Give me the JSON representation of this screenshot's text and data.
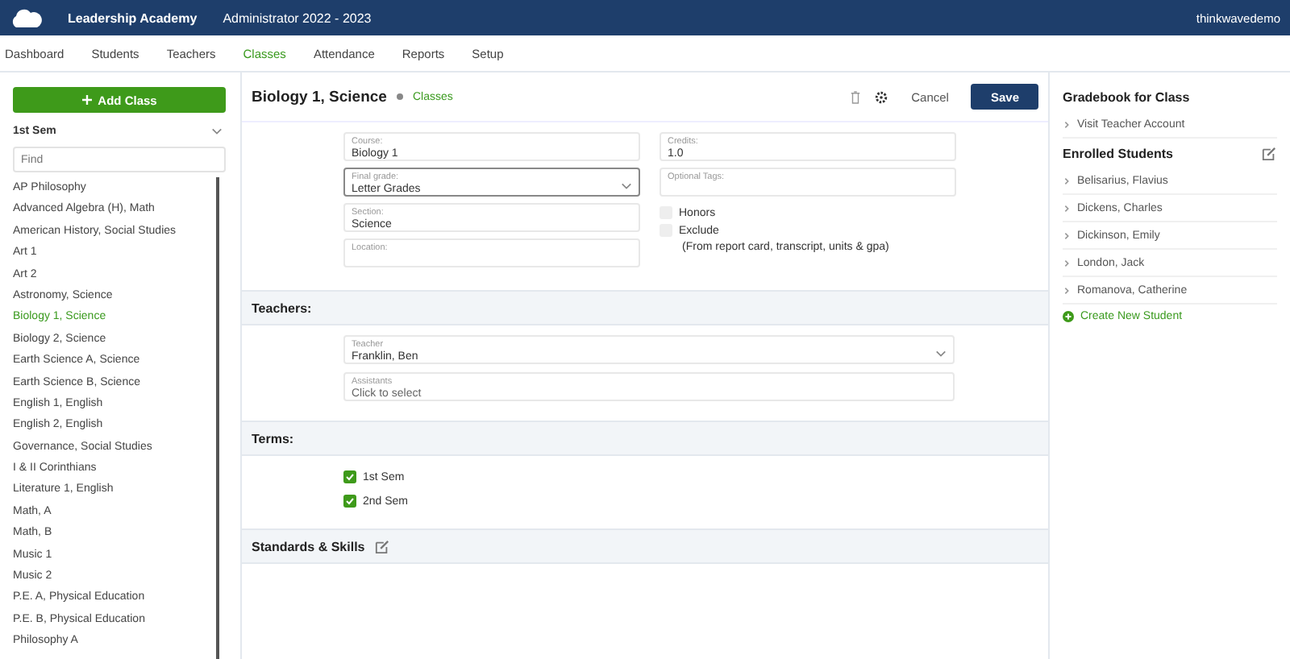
{
  "header": {
    "school": "Leadership Academy",
    "term": "Administrator 2022 - 2023",
    "user": "thinkwavedemo"
  },
  "nav": [
    {
      "label": "Dashboard",
      "selected": false
    },
    {
      "label": "Students",
      "selected": false
    },
    {
      "label": "Teachers",
      "selected": false
    },
    {
      "label": "Classes",
      "selected": true
    },
    {
      "label": "Attendance",
      "selected": false
    },
    {
      "label": "Reports",
      "selected": false
    },
    {
      "label": "Setup",
      "selected": false
    }
  ],
  "sidebar": {
    "add_button": "Add Class",
    "term_select": "1st Sem",
    "search": {
      "placeholder": "Find"
    },
    "items": [
      {
        "label": "AP Philosophy",
        "selected": false
      },
      {
        "label": "Advanced Algebra (H), Math",
        "selected": false
      },
      {
        "label": "American History, Social Studies",
        "selected": false
      },
      {
        "label": "Art 1",
        "selected": false
      },
      {
        "label": "Art 2",
        "selected": false
      },
      {
        "label": "Astronomy, Science",
        "selected": false
      },
      {
        "label": "Biology 1, Science",
        "selected": true
      },
      {
        "label": "Biology 2, Science",
        "selected": false
      },
      {
        "label": "Earth Science A, Science",
        "selected": false
      },
      {
        "label": "Earth Science B, Science",
        "selected": false
      },
      {
        "label": "English 1, English",
        "selected": false
      },
      {
        "label": "English 2, English",
        "selected": false
      },
      {
        "label": "Governance, Social Studies",
        "selected": false
      },
      {
        "label": "I & II Corinthians",
        "selected": false
      },
      {
        "label": "Literature 1, English",
        "selected": false
      },
      {
        "label": "Math, A",
        "selected": false
      },
      {
        "label": "Math, B",
        "selected": false
      },
      {
        "label": "Music 1",
        "selected": false
      },
      {
        "label": "Music 2",
        "selected": false
      },
      {
        "label": "P.E. A, Physical Education",
        "selected": false
      },
      {
        "label": "P.E. B, Physical Education",
        "selected": false
      },
      {
        "label": "Philosophy A",
        "selected": false
      }
    ]
  },
  "main": {
    "title": "Biology 1, Science",
    "breadcrumb": "Classes",
    "cancel": "Cancel",
    "save": "Save",
    "fields": [
      {
        "label": "Course:",
        "value": "Biology 1",
        "kind": "text"
      },
      {
        "label": "Credits:",
        "value": "1.0",
        "kind": "text"
      },
      {
        "label": "Final grade:",
        "value": "Letter Grades",
        "kind": "select"
      },
      {
        "label": "Optional Tags:",
        "kind": "text"
      },
      {
        "label": "Section:",
        "value": "Science",
        "kind": "text"
      },
      {
        "label": "Location:",
        "kind": "text"
      }
    ],
    "options": [
      {
        "label": "Honors",
        "checked": false
      },
      {
        "label": "Exclude",
        "checked": false,
        "note": "(From report card, transcript, units & gpa)"
      }
    ],
    "teachers": {
      "heading": "Teachers:",
      "teacher": {
        "label": "Teacher",
        "value": "Franklin, Ben"
      },
      "assistants": {
        "label": "Assistants",
        "placeholder": "Click to select"
      }
    },
    "terms": {
      "heading": "Terms:",
      "items": [
        {
          "label": "1st Sem",
          "checked": true
        },
        {
          "label": "2nd Sem",
          "checked": true
        }
      ]
    },
    "standards": {
      "heading": "Standards & Skills"
    }
  },
  "right_panel": {
    "gradebook_heading": "Gradebook for Class",
    "gradebook_link": "Visit Teacher Account",
    "students_heading": "Enrolled Students",
    "students": [
      "Belisarius, Flavius",
      "Dickens, Charles",
      "Dickinson, Emily",
      "London, Jack",
      "Romanova, Catherine"
    ],
    "create_link": "Create New Student"
  }
}
